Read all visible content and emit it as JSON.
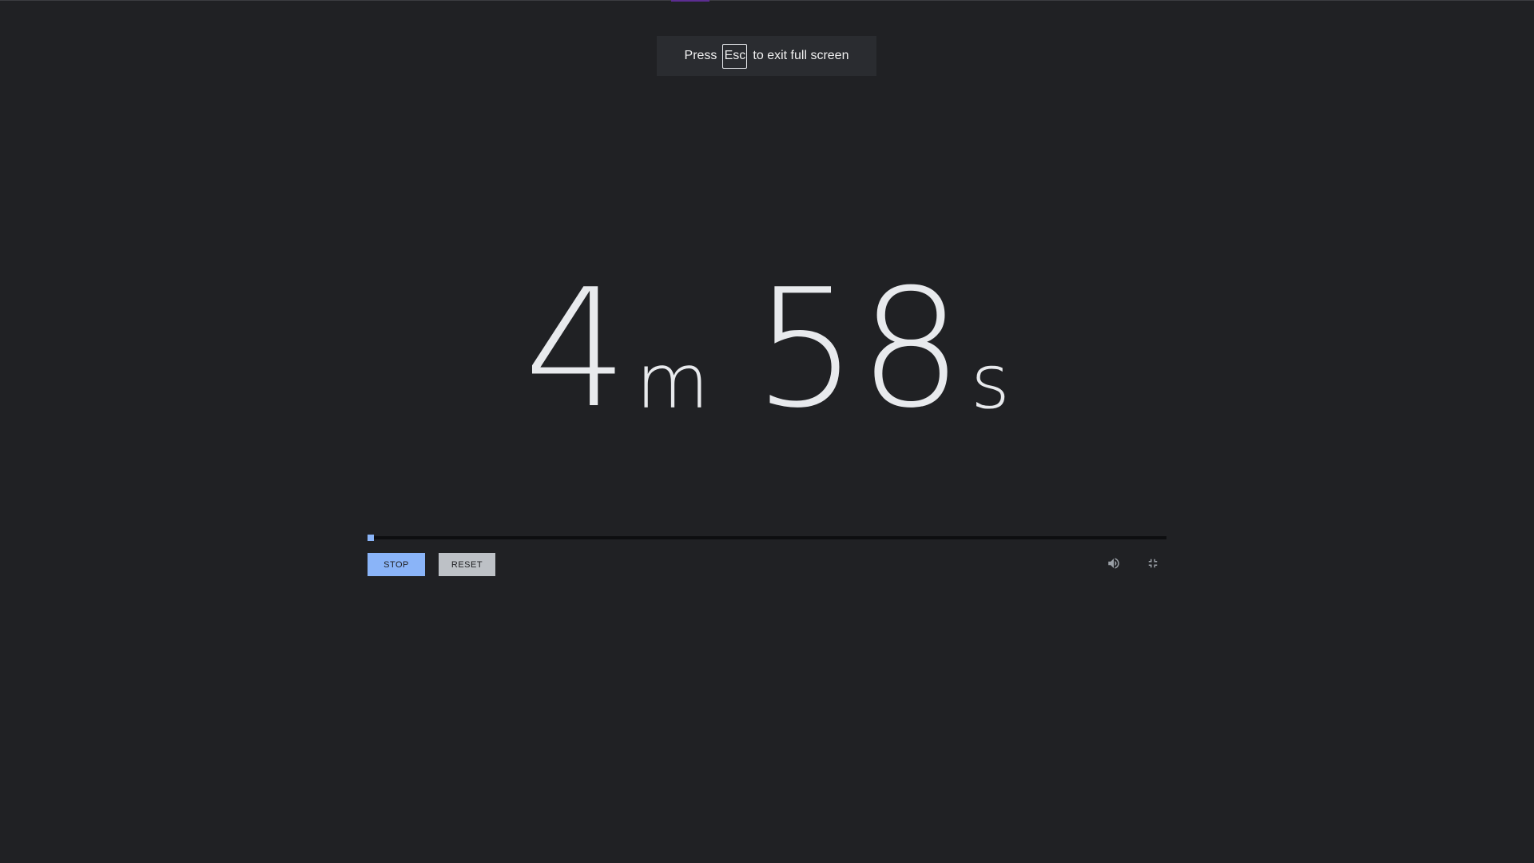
{
  "toast": {
    "press": "Press",
    "key": "Esc",
    "message": "to exit full screen"
  },
  "timer": {
    "minutes": "4",
    "minutes_unit": "m",
    "seconds": "58",
    "seconds_unit": "s"
  },
  "progress": {
    "fraction": 0.008
  },
  "controls": {
    "stop_label": "STOP",
    "reset_label": "RESET",
    "volume_icon": "volume-icon",
    "exit_fullscreen_icon": "exit-fullscreen-icon"
  },
  "colors": {
    "background": "#202124",
    "accent": "#8ab4f8",
    "reset_button": "#bdc1c6",
    "digits": "#e8eaed",
    "icon": "#9aa0a6"
  }
}
